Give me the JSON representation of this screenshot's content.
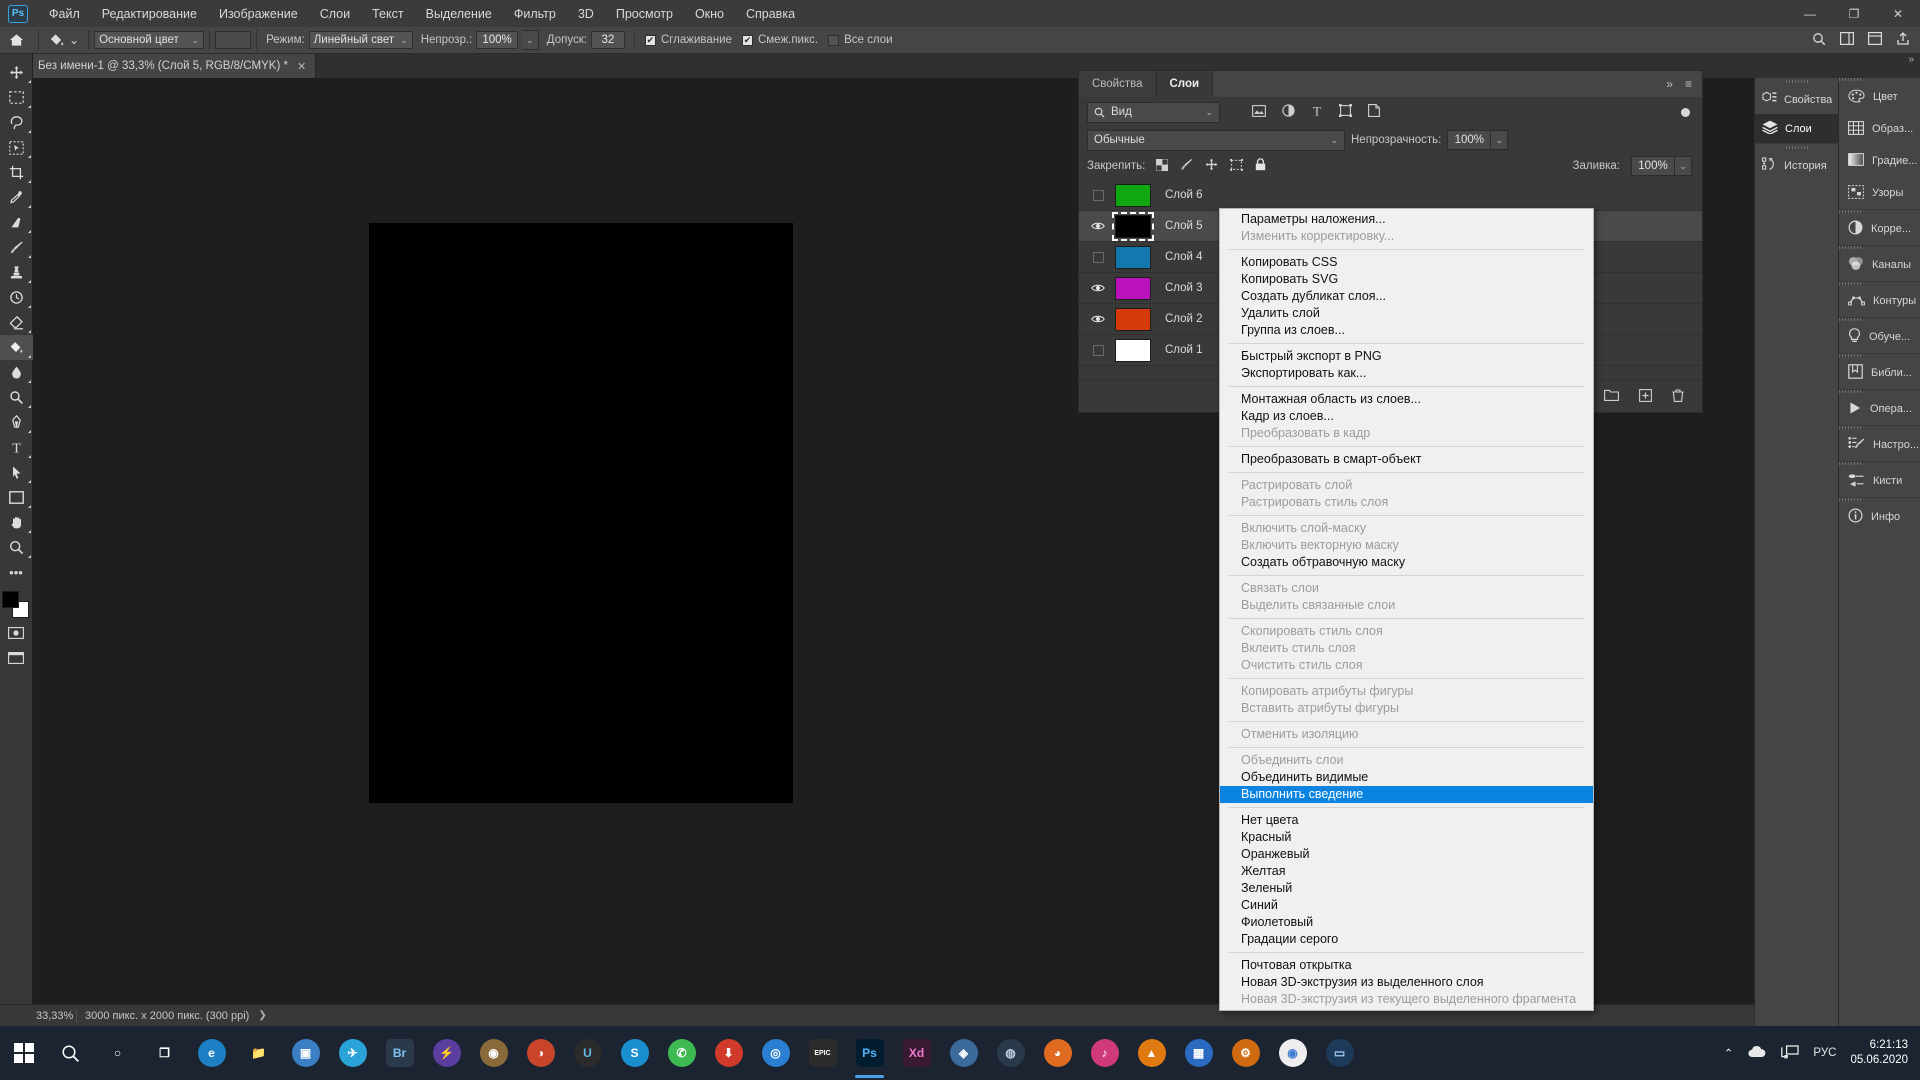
{
  "menubar": {
    "logo": "Ps",
    "items": [
      "Файл",
      "Редактирование",
      "Изображение",
      "Слои",
      "Текст",
      "Выделение",
      "Фильтр",
      "3D",
      "Просмотр",
      "Окно",
      "Справка"
    ],
    "window_buttons": [
      "—",
      "❐",
      "✕"
    ]
  },
  "options_bar": {
    "home_icon": "home-icon",
    "tool_icon": "paint-bucket-icon",
    "fill_source": "Основной цвет",
    "mode_label": "Режим:",
    "mode_value": "Линейный свет",
    "opacity_label": "Непрозр.:",
    "opacity_value": "100%",
    "tolerance_label": "Допуск:",
    "tolerance_value": "32",
    "antialias_label": "Сглаживание",
    "contiguous_label": "Смеж.пикс.",
    "all_layers_label": "Все слои",
    "right_icons": [
      "search-icon",
      "workspace-icon",
      "arrange-icon",
      "share-icon"
    ]
  },
  "document_tab": {
    "title": "Без имени-1 @ 33,3% (Слой 5, RGB/8/CMYK) *",
    "close": "✕",
    "overflow_chevron": "»"
  },
  "toolbar": {
    "tools": [
      "move-tool",
      "rectangular-marquee-tool",
      "lasso-tool",
      "object-selection-tool",
      "crop-tool",
      "eyedropper-tool",
      "spot-healing-brush-tool",
      "brush-tool",
      "clone-stamp-tool",
      "history-brush-tool",
      "eraser-tool",
      "paint-bucket-tool",
      "blur-tool",
      "dodge-tool",
      "pen-tool",
      "type-tool",
      "path-selection-tool",
      "rectangle-tool",
      "hand-tool",
      "zoom-tool",
      "more-tools",
      "default-colors",
      "foreground-background-color",
      "quick-mask-mode",
      "screen-mode"
    ],
    "foreground_color": "#000000",
    "background_color": "#ffffff"
  },
  "layers_panel": {
    "tabs": [
      {
        "label": "Свойства",
        "active": false
      },
      {
        "label": "Слои",
        "active": true
      }
    ],
    "collapse_icon": "»",
    "menu_icon": "≡",
    "filter": {
      "placeholder": "Вид",
      "icon": "search-icon",
      "chevron": "⌄"
    },
    "kind_filters": [
      "pixel-layer-filter-icon",
      "adjustment-layer-filter-icon",
      "type-layer-filter-icon",
      "shape-layer-filter-icon",
      "smart-object-filter-icon"
    ],
    "filter_toggle": "filter-enable-toggle",
    "blend_mode": "Обычные",
    "opacity_label": "Непрозрачность:",
    "opacity_value": "100%",
    "lock_label": "Закрепить:",
    "lock_icons": [
      "lock-transparent-pixels-icon",
      "lock-image-pixels-icon",
      "lock-position-icon",
      "lock-artboard-nesting-icon",
      "lock-all-icon"
    ],
    "fill_label": "Заливка:",
    "fill_value": "100%",
    "layers": [
      {
        "name": "Слой 6",
        "color": "#10a810",
        "visible": false,
        "selected": false
      },
      {
        "name": "Слой 5",
        "color": "#000000",
        "visible": true,
        "selected": true
      },
      {
        "name": "Слой 4",
        "color": "#1278ad",
        "visible": false,
        "selected": false
      },
      {
        "name": "Слой 3",
        "color": "#bb11bb",
        "visible": true,
        "selected": false
      },
      {
        "name": "Слой 2",
        "color": "#d43a0a",
        "visible": true,
        "selected": false
      },
      {
        "name": "Слой 1",
        "color": "#ffffff",
        "visible": false,
        "selected": false
      }
    ],
    "footer_icons": [
      "link-layers-icon",
      "layer-style-icon",
      "add-layer-mask-icon",
      "new-adjustment-layer-icon",
      "new-group-icon",
      "new-layer-icon",
      "delete-layer-icon"
    ]
  },
  "context_menu": {
    "highlight_color": "#0a84e0",
    "groups": [
      [
        {
          "label": "Параметры наложения...",
          "state": "normal"
        },
        {
          "label": "Изменить корректировку...",
          "state": "disabled"
        }
      ],
      [
        {
          "label": "Копировать CSS",
          "state": "normal"
        },
        {
          "label": "Копировать SVG",
          "state": "normal"
        },
        {
          "label": "Создать дубликат слоя...",
          "state": "normal"
        },
        {
          "label": "Удалить слой",
          "state": "normal"
        },
        {
          "label": "Группа из слоев...",
          "state": "normal"
        }
      ],
      [
        {
          "label": "Быстрый экспорт в PNG",
          "state": "normal"
        },
        {
          "label": "Экспортировать как...",
          "state": "normal"
        }
      ],
      [
        {
          "label": "Монтажная область из слоев...",
          "state": "normal"
        },
        {
          "label": "Кадр из слоев...",
          "state": "normal"
        },
        {
          "label": "Преобразовать в кадр",
          "state": "disabled"
        }
      ],
      [
        {
          "label": "Преобразовать в смарт-объект",
          "state": "normal"
        }
      ],
      [
        {
          "label": "Растрировать слой",
          "state": "disabled"
        },
        {
          "label": "Растрировать стиль слоя",
          "state": "disabled"
        }
      ],
      [
        {
          "label": "Включить слой-маску",
          "state": "disabled"
        },
        {
          "label": "Включить векторную маску",
          "state": "disabled"
        },
        {
          "label": "Создать обтравочную маску",
          "state": "normal"
        }
      ],
      [
        {
          "label": "Связать слои",
          "state": "disabled"
        },
        {
          "label": "Выделить связанные слои",
          "state": "disabled"
        }
      ],
      [
        {
          "label": "Скопировать стиль слоя",
          "state": "disabled"
        },
        {
          "label": "Вклеить стиль слоя",
          "state": "disabled"
        },
        {
          "label": "Очистить стиль слоя",
          "state": "disabled"
        }
      ],
      [
        {
          "label": "Копировать атрибуты фигуры",
          "state": "disabled"
        },
        {
          "label": "Вставить атрибуты фигуры",
          "state": "disabled"
        }
      ],
      [
        {
          "label": "Отменить изоляцию",
          "state": "disabled"
        }
      ],
      [
        {
          "label": "Объединить слои",
          "state": "disabled"
        },
        {
          "label": "Объединить видимые",
          "state": "normal"
        },
        {
          "label": "Выполнить сведение",
          "state": "highlight"
        }
      ],
      [
        {
          "label": "Нет цвета",
          "state": "normal"
        },
        {
          "label": "Красный",
          "state": "normal"
        },
        {
          "label": "Оранжевый",
          "state": "normal"
        },
        {
          "label": "Желтая",
          "state": "normal"
        },
        {
          "label": "Зеленый",
          "state": "normal"
        },
        {
          "label": "Синий",
          "state": "normal"
        },
        {
          "label": "Фиолетовый",
          "state": "normal"
        },
        {
          "label": "Градации серого",
          "state": "normal"
        }
      ],
      [
        {
          "label": "Почтовая открытка",
          "state": "normal"
        },
        {
          "label": "Новая 3D-экструзия из выделенного слоя",
          "state": "normal"
        },
        {
          "label": "Новая 3D-экструзия из текущего выделенного фрагмента",
          "state": "disabled"
        }
      ]
    ]
  },
  "dock_wide": {
    "groups": [
      [
        {
          "label": "Свойства",
          "icon": "properties-icon",
          "active": false
        },
        {
          "label": "Слои",
          "icon": "layers-icon",
          "active": true
        }
      ],
      [
        {
          "label": "История",
          "icon": "history-icon",
          "active": false
        }
      ]
    ]
  },
  "dock_narrow": {
    "collapse_icon": "»",
    "groups": [
      [
        {
          "label": "Цвет",
          "icon": "color-palette-icon"
        },
        {
          "label": "Образ...",
          "icon": "swatches-icon"
        },
        {
          "label": "Градие...",
          "icon": "gradients-icon"
        },
        {
          "label": "Узоры",
          "icon": "patterns-icon"
        }
      ],
      [
        {
          "label": "Корре...",
          "icon": "adjustments-icon"
        }
      ],
      [
        {
          "label": "Каналы",
          "icon": "channels-icon"
        }
      ],
      [
        {
          "label": "Контуры",
          "icon": "paths-icon"
        }
      ],
      [
        {
          "label": "Обуче...",
          "icon": "learn-icon"
        }
      ],
      [
        {
          "label": "Библи...",
          "icon": "libraries-icon"
        }
      ],
      [
        {
          "label": "Опера...",
          "icon": "actions-icon"
        }
      ],
      [
        {
          "label": "Настро...",
          "icon": "brush-settings-icon"
        }
      ],
      [
        {
          "label": "Кисти",
          "icon": "brushes-icon"
        }
      ],
      [
        {
          "label": "Инфо",
          "icon": "info-icon"
        }
      ]
    ]
  },
  "status_bar": {
    "zoom": "33,33%",
    "doc_info": "3000 пикс. x 2000 пикс. (300 ppi)",
    "arrow": "❯"
  },
  "taskbar": {
    "start_icon": "windows-start-icon",
    "search_icon": "search-icon",
    "apps": [
      {
        "name": "cortana-icon",
        "glyph": "○",
        "bg": "transparent",
        "fg": "#ffffff"
      },
      {
        "name": "task-view-icon",
        "glyph": "❐",
        "bg": "transparent",
        "fg": "#ffffff"
      },
      {
        "name": "edge-icon",
        "glyph": "e",
        "bg": "#1e7fc4",
        "fg": "#ffffff"
      },
      {
        "name": "file-explorer-icon",
        "glyph": "📁",
        "bg": "#e8b councils",
        "fg": "#ffd066"
      },
      {
        "name": "store-icon",
        "glyph": "▣",
        "bg": "#3a7ec4",
        "fg": "#ffffff"
      },
      {
        "name": "telegram-icon",
        "glyph": "✈",
        "bg": "#2aa3d8",
        "fg": "#ffffff"
      },
      {
        "name": "adobe-bridge-icon",
        "glyph": "Br",
        "bg": "#2b3a4a",
        "fg": "#7ec0f0"
      },
      {
        "name": "torrent-icon",
        "glyph": "⚡",
        "bg": "#5a3fa0",
        "fg": "#ffd040"
      },
      {
        "name": "gimp-icon",
        "glyph": "◉",
        "bg": "#8a6a3a",
        "fg": "#ffffff"
      },
      {
        "name": "firefox-dev-icon",
        "glyph": "◑",
        "bg": "#c8442a",
        "fg": "#ffffff"
      },
      {
        "name": "unity-icon",
        "glyph": "U",
        "bg": "#2b2b2b",
        "fg": "#60b8e8"
      },
      {
        "name": "skype-icon",
        "glyph": "S",
        "bg": "#1a8fd0",
        "fg": "#ffffff"
      },
      {
        "name": "whatsapp-icon",
        "glyph": "✆",
        "bg": "#3fba52",
        "fg": "#ffffff"
      },
      {
        "name": "downloads-icon",
        "glyph": "⬇",
        "bg": "#d03a2a",
        "fg": "#ffffff"
      },
      {
        "name": "browser-icon",
        "glyph": "◎",
        "bg": "#2a7fd0",
        "fg": "#ffffff"
      },
      {
        "name": "epic-games-icon",
        "glyph": "EPIC",
        "bg": "#2b2b2b",
        "fg": "#ffffff"
      },
      {
        "name": "photoshop-icon",
        "glyph": "Ps",
        "bg": "#021d30",
        "fg": "#4fb3f5"
      },
      {
        "name": "adobe-xd-icon",
        "glyph": "Xd",
        "bg": "#3a1a33",
        "fg": "#f07ad0"
      },
      {
        "name": "blender-icon",
        "glyph": "◈",
        "bg": "#3a6a9a",
        "fg": "#ffffff"
      },
      {
        "name": "steam-icon",
        "glyph": "◍",
        "bg": "#2a3a4a",
        "fg": "#bcd0e0"
      },
      {
        "name": "firefox-icon",
        "glyph": "◕",
        "bg": "#e06a20",
        "fg": "#ffffff"
      },
      {
        "name": "music-icon",
        "glyph": "♪",
        "bg": "#d03a7a",
        "fg": "#ffffff"
      },
      {
        "name": "vlc-icon",
        "glyph": "▲",
        "bg": "#e07a10",
        "fg": "#ffffff"
      },
      {
        "name": "photos-icon",
        "glyph": "▦",
        "bg": "#2a6ac0",
        "fg": "#ffffff"
      },
      {
        "name": "settings-gear-icon",
        "glyph": "⚙",
        "bg": "#d06a10",
        "fg": "#ffffff"
      },
      {
        "name": "chrome-icon",
        "glyph": "◉",
        "bg": "#eeeeee",
        "fg": "#3a7ad0"
      },
      {
        "name": "terminal-icon",
        "glyph": "▭",
        "bg": "#1e3a5a",
        "fg": "#9ecbf0"
      }
    ],
    "tray": {
      "chevron": "⌃",
      "cloud_icon": "onedrive-icon",
      "network_icon": "network-icon",
      "language": "РУС",
      "time": "6:21:13",
      "date": "05.06.2020"
    }
  }
}
